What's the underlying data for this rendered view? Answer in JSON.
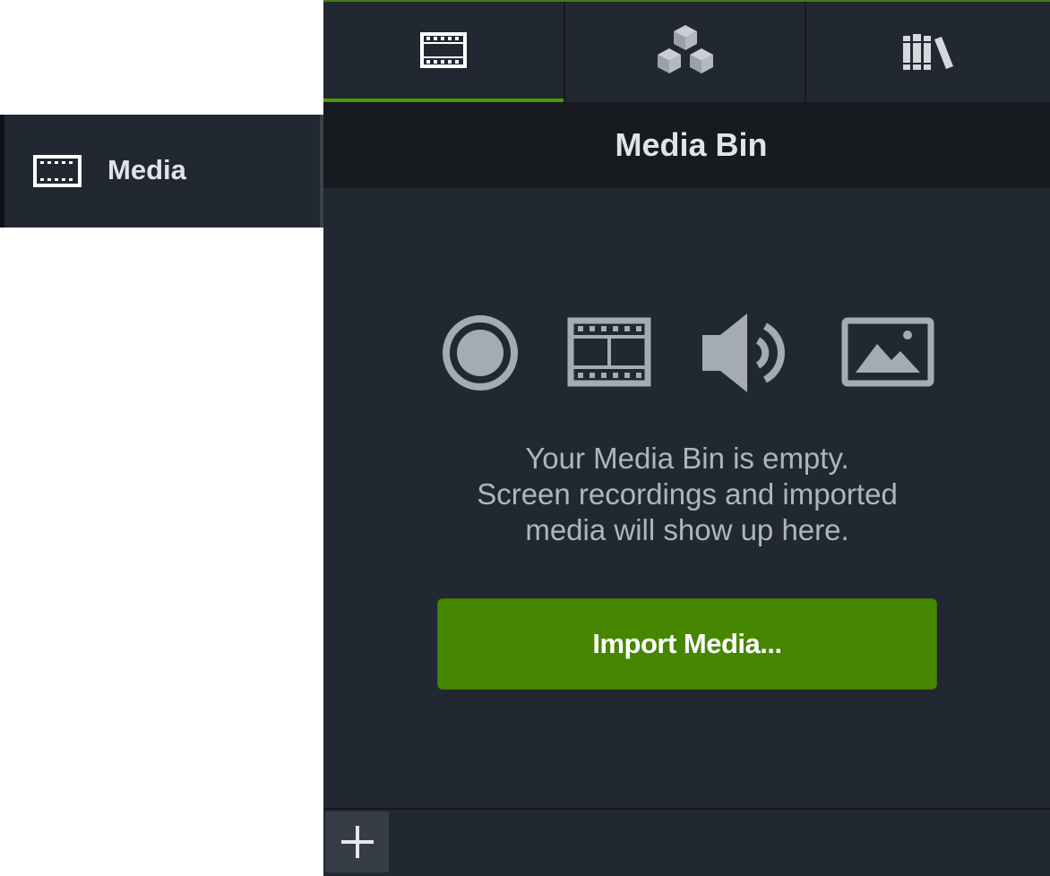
{
  "sidebar": {
    "item": {
      "label": "Media",
      "icon": "film-strip-icon"
    }
  },
  "tabs": [
    {
      "icon": "film-strip-icon",
      "active": true
    },
    {
      "icon": "cubes-icon",
      "active": false
    },
    {
      "icon": "library-books-icon",
      "active": false
    }
  ],
  "panel": {
    "title": "Media Bin",
    "media_type_icons": [
      "record-icon",
      "film-strip-icon",
      "speaker-icon",
      "image-icon"
    ],
    "empty_message": {
      "line1": "Your Media Bin is empty.",
      "line2": "Screen recordings and imported",
      "line3": "media will show up here."
    },
    "import_button": "Import Media...",
    "add_button_icon": "plus-icon"
  },
  "colors": {
    "panel_bg": "#222831",
    "header_bg": "#171b20",
    "accent_green": "#468600",
    "tab_indicator": "#4b9a0a",
    "text_light": "#dfe4ea",
    "text_muted": "#aeb5be"
  }
}
